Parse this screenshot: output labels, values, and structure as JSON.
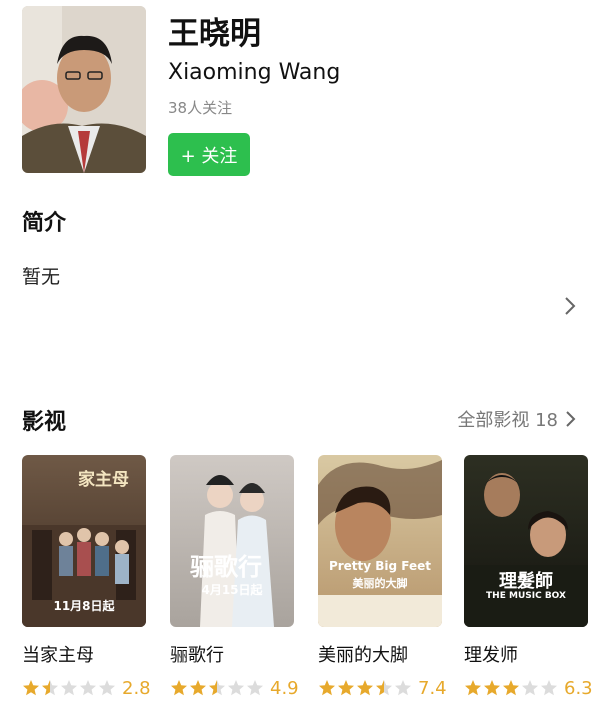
{
  "person": {
    "name_cn": "王晓明",
    "name_en": "Xiaoming Wang",
    "followers": "38人关注",
    "follow_label": "+ 关注"
  },
  "intro": {
    "title": "简介",
    "text": "暂无"
  },
  "films": {
    "title": "影视",
    "all_label": "全部影视 18",
    "items": [
      {
        "title": "当家主母",
        "score": "2.8",
        "stars": 1.5,
        "poster_caption": "11月8日起"
      },
      {
        "title": "骊歌行",
        "score": "4.9",
        "stars": 2.5,
        "poster_caption": "4月15日起",
        "poster_title": "骊歌行"
      },
      {
        "title": "美丽的大脚",
        "score": "7.4",
        "stars": 3.5,
        "poster_caption": "Pretty Big Feet",
        "poster_subtitle": "美丽的大脚"
      },
      {
        "title": "理发师",
        "score": "6.3",
        "stars": 3,
        "poster_title": "理髮師",
        "poster_subtitle": "THE MUSIC BOX"
      }
    ]
  },
  "colors": {
    "accent_green": "#2dbf4e",
    "star_filled": "#e7a92c",
    "star_empty": "#dcdcdc"
  }
}
